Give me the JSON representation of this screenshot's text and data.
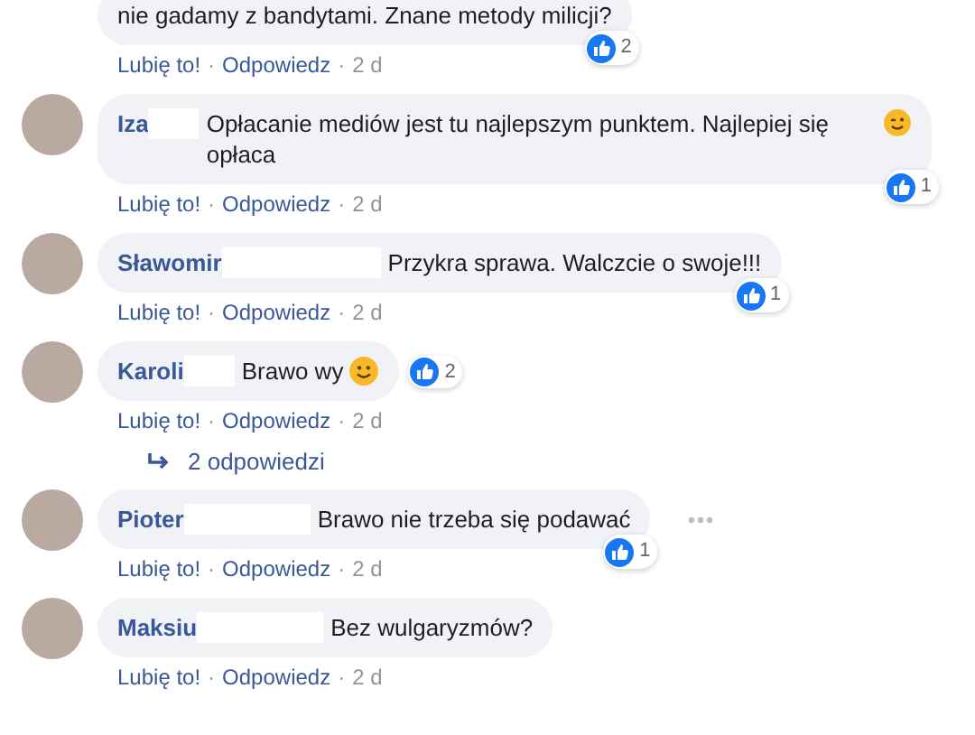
{
  "comments": [
    {
      "text": "nie gadamy z bandytami. Znane metody milicji?",
      "reactions": {
        "count": "2",
        "inline": false
      },
      "meta": [
        {
          "kind": "link",
          "text": "Lubię to!"
        },
        {
          "kind": "sep",
          "text": "·"
        },
        {
          "kind": "link",
          "text": "Odpowiedz"
        },
        {
          "kind": "sep",
          "text": "·"
        },
        {
          "kind": "time",
          "text": "2 d"
        }
      ],
      "avatar": false,
      "options": false
    },
    {
      "name": "Iza",
      "text": "Opłacanie mediów jest tu najlepszym punktem. Najlepiej się opłaca",
      "redacted": true,
      "emoji": {
        "kind": "wink"
      },
      "reactions": {
        "count": "1",
        "inline": false
      },
      "meta": [
        {
          "kind": "link",
          "text": "Lubię to!"
        },
        {
          "kind": "sep",
          "text": "·"
        },
        {
          "kind": "link",
          "text": "Odpowiedz"
        },
        {
          "kind": "sep",
          "text": "·"
        },
        {
          "kind": "time",
          "text": "2 d"
        }
      ],
      "avatar": true,
      "options": false
    },
    {
      "name": "Sławomir",
      "text": "Przykra sprawa. Walczcie o swoje!!!",
      "redacted": true,
      "reactions": {
        "count": "1",
        "inline": false
      },
      "meta": [
        {
          "kind": "link",
          "text": "Lubię to!"
        },
        {
          "kind": "sep",
          "text": "·"
        },
        {
          "kind": "link",
          "text": "Odpowiedz"
        },
        {
          "kind": "sep",
          "text": "·"
        },
        {
          "kind": "time",
          "text": "2 d"
        }
      ],
      "avatar": true,
      "options": false
    },
    {
      "name": "Karoli",
      "text": "Brawo wy",
      "redacted": true,
      "emoji": {
        "kind": "smile"
      },
      "reactions": {
        "count": "2",
        "inline": true
      },
      "meta": [
        {
          "kind": "link",
          "text": "Lubię to!"
        },
        {
          "kind": "sep",
          "text": "·"
        },
        {
          "kind": "link",
          "text": "Odpowiedz"
        },
        {
          "kind": "sep",
          "text": "·"
        },
        {
          "kind": "time",
          "text": "2 d"
        }
      ],
      "avatar": true,
      "options": false,
      "replies": "2 odpowiedzi"
    },
    {
      "name": "Pioter",
      "text": "Brawo nie trzeba się podawać",
      "redacted": true,
      "reactions": {
        "count": "1",
        "inline": false
      },
      "meta": [
        {
          "kind": "link",
          "text": "Lubię to!"
        },
        {
          "kind": "sep",
          "text": "·"
        },
        {
          "kind": "link",
          "text": "Odpowiedz"
        },
        {
          "kind": "sep",
          "text": "·"
        },
        {
          "kind": "time",
          "text": "2 d"
        }
      ],
      "avatar": true,
      "options": true
    },
    {
      "name": "Maksiu",
      "text": "Bez wulgaryzmów?",
      "redacted": true,
      "meta": [
        {
          "kind": "link",
          "text": "Lubię to!"
        },
        {
          "kind": "sep",
          "text": "·"
        },
        {
          "kind": "link",
          "text": "Odpowiedz"
        },
        {
          "kind": "sep",
          "text": "·"
        },
        {
          "kind": "time",
          "text": "2 d"
        }
      ],
      "avatar": true,
      "options": false
    }
  ]
}
